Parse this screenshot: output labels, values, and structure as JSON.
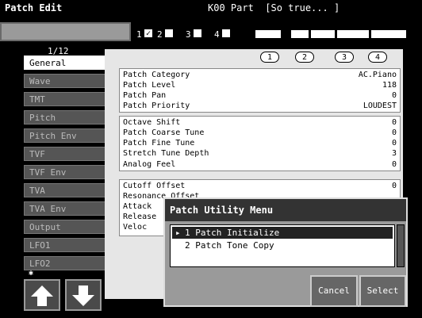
{
  "window": {
    "title": "Patch Edit",
    "part_label": "K00 Part",
    "patch_name": "[So true... ]"
  },
  "tone_selector": {
    "numbers": [
      "1",
      "2",
      "3",
      "4"
    ]
  },
  "sidebar": {
    "page": "1/12",
    "tabs": [
      "General",
      "Wave",
      "TMT",
      "Pitch",
      "Pitch Env",
      "TVF",
      "TVF Env",
      "TVA",
      "TVA Env",
      "Output",
      "LFO1",
      "LFO2"
    ],
    "active_index": 0
  },
  "tones": [
    "1",
    "2",
    "3",
    "4"
  ],
  "params": {
    "group1": [
      {
        "label": "Patch Category",
        "value": "AC.Piano"
      },
      {
        "label": "Patch Level",
        "value": "118"
      },
      {
        "label": "Patch Pan",
        "value": "0"
      },
      {
        "label": "Patch Priority",
        "value": "LOUDEST"
      }
    ],
    "group2": [
      {
        "label": "Octave Shift",
        "value": "0"
      },
      {
        "label": "Patch Coarse Tune",
        "value": "0"
      },
      {
        "label": "Patch Fine Tune",
        "value": "0"
      },
      {
        "label": "Stretch Tune Depth",
        "value": "3"
      },
      {
        "label": "Analog Feel",
        "value": "0"
      }
    ],
    "group3": [
      {
        "label": "Cutoff Offset",
        "value": "0"
      },
      {
        "label": "Resonance Offset",
        "value": ""
      },
      {
        "label": "Attack",
        "value": ""
      },
      {
        "label": "Release",
        "value": ""
      },
      {
        "label": "Veloc",
        "value": ""
      }
    ]
  },
  "dialog": {
    "title": "Patch Utility Menu",
    "items": [
      "1 Patch Initialize",
      "2 Patch Tone Copy"
    ],
    "selected_index": 0,
    "cancel_label": "Cancel",
    "select_label": "Select"
  }
}
